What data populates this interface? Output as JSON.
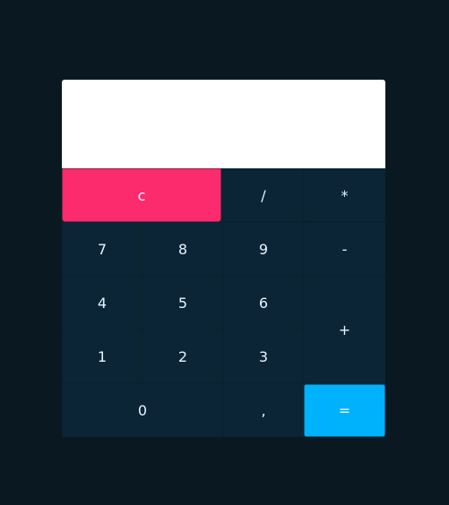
{
  "display": {
    "value": ""
  },
  "keys": {
    "clear": "c",
    "divide": "/",
    "multiply": "*",
    "seven": "7",
    "eight": "8",
    "nine": "9",
    "minus": "-",
    "four": "4",
    "five": "5",
    "six": "6",
    "plus": "+",
    "one": "1",
    "two": "2",
    "three": "3",
    "zero": "0",
    "comma": ",",
    "equals": "="
  },
  "colors": {
    "background": "#0a1822",
    "keypad": "#0c2536",
    "clear": "#fb2b6e",
    "equals": "#00b1fb"
  }
}
